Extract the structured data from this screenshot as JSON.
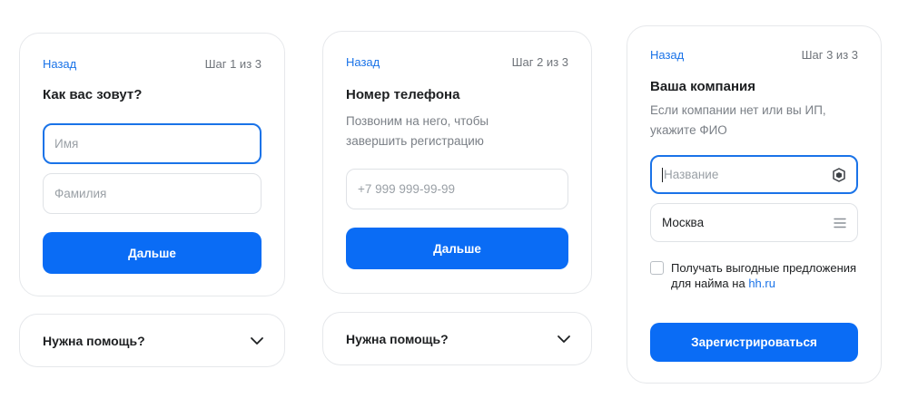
{
  "step1": {
    "back": "Назад",
    "step": "Шаг 1 из 3",
    "title": "Как вас зовут?",
    "first_name_placeholder": "Имя",
    "last_name_placeholder": "Фамилия",
    "next": "Дальше"
  },
  "step2": {
    "back": "Назад",
    "step": "Шаг 2 из 3",
    "title": "Номер телефона",
    "subtitle": "Позвоним на него, чтобы завершить регистрацию",
    "phone_placeholder": "+7 999 999-99-99",
    "next": "Дальше"
  },
  "step3": {
    "back": "Назад",
    "step": "Шаг 3 из 3",
    "title": "Ваша компания",
    "subtitle": "Если компании нет или вы ИП, укажите ФИО",
    "company_placeholder": "Название",
    "city": "Москва",
    "offers_text": "Получать выгодные предложения для найма на",
    "offers_link": "hh.ru",
    "submit": "Зарегистрироваться"
  },
  "help": {
    "label": "Нужна помощь?"
  },
  "icons": {
    "company_field_icon": "shield-icon",
    "city_field_icon": "menu-lines-icon",
    "help_toggle_icon": "chevron-down-icon"
  },
  "colors": {
    "accent": "#0a6cf5",
    "link": "#1a73e8"
  }
}
